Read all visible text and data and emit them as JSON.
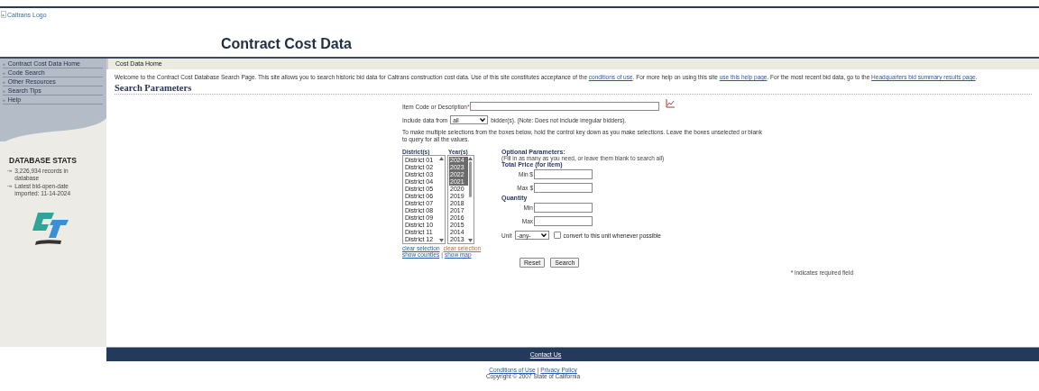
{
  "header": {
    "logo_alt": "Caltrans Logo",
    "title": "Contract Cost Data"
  },
  "sidebar": {
    "items": [
      {
        "label": "Contract Cost Data Home"
      },
      {
        "label": "Code Search"
      },
      {
        "label": "Other Resources"
      },
      {
        "label": "Search Tips"
      },
      {
        "label": "Help"
      }
    ],
    "stats_title": "DATABASE STATS",
    "stats": [
      "3,226,934 records in database",
      "Latest bid-open-date imported: 11-14-2024"
    ],
    "arrow": "-»",
    "bullet": "»"
  },
  "breadcrumb": "Cost Data Home",
  "welcome": [
    {
      "kind": "text",
      "text": "Welcome to the Contract Cost Database Search Page. This site allows you to search historic bid data for Caltrans construction cost data. Use of this site constitutes acceptance of the "
    },
    {
      "kind": "link",
      "text": "conditions of use"
    },
    {
      "kind": "text",
      "text": ". For more help on using this site "
    },
    {
      "kind": "link",
      "text": "use this help page"
    },
    {
      "kind": "text",
      "text": ". For the most recent bid data, go to the "
    },
    {
      "kind": "link",
      "text": "Headquarters bid summary results page"
    },
    {
      "kind": "text",
      "text": "."
    }
  ],
  "section_title": "Search Parameters",
  "form": {
    "item_label": "Item Code or Description",
    "required_mark": "*",
    "include_prefix": "Include data from",
    "bidders": "all",
    "include_suffix": "bidder(s). (Note: Does not include irregular bidders).",
    "instructions": "To make multiple selections from the boxes below, hold the control key down as you make selections. Leave the boxes unselected or blank to query for all the values.",
    "districts_label": "District(s)",
    "years_label": "Year(s)",
    "districts": [
      {
        "label": "District 01",
        "selected": false
      },
      {
        "label": "District 02",
        "selected": false
      },
      {
        "label": "District 03",
        "selected": false
      },
      {
        "label": "District 04",
        "selected": false
      },
      {
        "label": "District 05",
        "selected": false
      },
      {
        "label": "District 06",
        "selected": false
      },
      {
        "label": "District 07",
        "selected": false
      },
      {
        "label": "District 08",
        "selected": false
      },
      {
        "label": "District 09",
        "selected": false
      },
      {
        "label": "District 10",
        "selected": false
      },
      {
        "label": "District 11",
        "selected": false
      },
      {
        "label": "District 12",
        "selected": false
      }
    ],
    "years": [
      {
        "label": "2024",
        "selected": true
      },
      {
        "label": "2023",
        "selected": true
      },
      {
        "label": "2022",
        "selected": true
      },
      {
        "label": "2021",
        "selected": true
      },
      {
        "label": "2020",
        "selected": false
      },
      {
        "label": "2019",
        "selected": false
      },
      {
        "label": "2018",
        "selected": false
      },
      {
        "label": "2017",
        "selected": false
      },
      {
        "label": "2016",
        "selected": false
      },
      {
        "label": "2015",
        "selected": false
      },
      {
        "label": "2014",
        "selected": false
      },
      {
        "label": "2013",
        "selected": false
      }
    ],
    "clear_district": "clear selection",
    "clear_year": "clear selection",
    "show_counties": "show counties",
    "separator": "|",
    "show_map": "show map",
    "optional_title": "Optional Parameters:",
    "optional_hint": "(Fill in as many as you need, or leave them blank to search all)",
    "price_title": "Total Price (for item)",
    "min_price": "Min $",
    "max_price": "Max $",
    "quantity_title": "Quantity",
    "min_qty": "Min",
    "max_qty": "Max",
    "unit_label": "Unit",
    "unit": "-any-",
    "convert_checked": false,
    "convert_label": "convert to this unit whenever possible",
    "buttons": [
      "Reset",
      "Search"
    ],
    "required_note": "* indicates required field"
  },
  "footer": {
    "contact": "Contact Us",
    "conditions": "Conditions of Use",
    "separator": "|",
    "privacy": "Privacy Policy",
    "copyright": "Copyright © 2007 State of California"
  }
}
